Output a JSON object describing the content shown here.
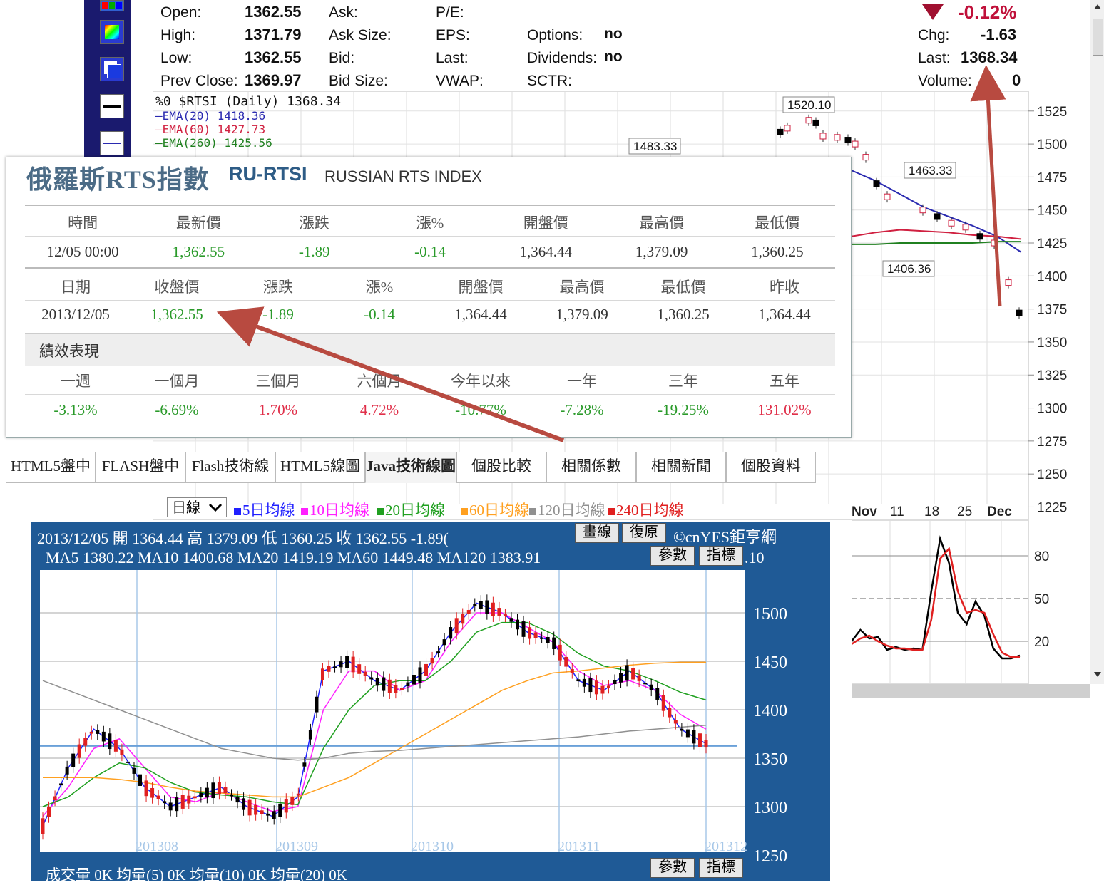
{
  "quote": {
    "open_label": "Open:",
    "open": "1362.55",
    "high_label": "High:",
    "high": "1371.79",
    "low_label": "Low:",
    "low": "1362.55",
    "prev_close_label": "Prev Close:",
    "prev_close": "1369.97",
    "ask_label": "Ask:",
    "ask_size_label": "Ask Size:",
    "bid_label": "Bid:",
    "bid_size_label": "Bid Size:",
    "pe_label": "P/E:",
    "eps_label": "EPS:",
    "last2_label": "Last:",
    "vwap_label": "VWAP:",
    "options_label": "Options:",
    "options": "no",
    "dividends_label": "Dividends:",
    "dividends": "no",
    "sctr_label": "SCTR:",
    "pct_change": "-0.12%",
    "chg_label": "Chg:",
    "chg": "-1.63",
    "last_label": "Last:",
    "last": "1368.34",
    "volume_label": "Volume:",
    "volume": "0"
  },
  "sc_chart": {
    "series_label": "$RTSI (Daily) 1368.34",
    "series_prefix": "%0",
    "ema20": "EMA(20) 1418.36",
    "ema60": "EMA(60) 1427.73",
    "ema260": "EMA(260) 1425.56",
    "annotations": [
      "1520.10",
      "1483.33",
      "1463.33",
      "1406.36"
    ],
    "x_ticks": [
      "Nov",
      "11",
      "18",
      "25",
      "Dec"
    ],
    "colors": {
      "ema20": "#2a2ab0",
      "ema60": "#d02040",
      "ema260": "#208020"
    }
  },
  "chart_data": [
    {
      "type": "line",
      "title": "$RTSI (Daily) 1368.34",
      "y_ticks": [
        "1525",
        "1500",
        "1475",
        "1450",
        "1425",
        "1400",
        "1375",
        "1350",
        "1325",
        "1300",
        "1275",
        "1250",
        "1225"
      ],
      "ylim": [
        1215,
        1540
      ],
      "x": [
        "Nov",
        "11",
        "18",
        "25",
        "Dec"
      ],
      "series": [
        {
          "name": "EMA(20) 1418.36",
          "values": [
            1480,
            1472,
            1462,
            1452,
            1445,
            1438,
            1430,
            1418
          ]
        },
        {
          "name": "EMA(60) 1427.73",
          "values": [
            1430,
            1433,
            1435,
            1434,
            1433,
            1431,
            1430,
            1428
          ]
        },
        {
          "name": "EMA(260) 1425.56",
          "values": [
            1424,
            1424,
            1425,
            1425,
            1425,
            1425,
            1426,
            1426
          ]
        }
      ]
    },
    {
      "type": "line",
      "title": "",
      "y_ticks": [
        "80",
        "50",
        "20"
      ],
      "ylim": [
        0,
        100
      ],
      "series": [
        {
          "name": "",
          "values": [
            20,
            28,
            22,
            23,
            14,
            16,
            14,
            15,
            14,
            55,
            92,
            75,
            40,
            32,
            48,
            38,
            15,
            8,
            8,
            10
          ]
        },
        {
          "name": "",
          "values": [
            18,
            22,
            24,
            20,
            17,
            15,
            15,
            14,
            14,
            35,
            78,
            85,
            55,
            40,
            42,
            40,
            25,
            12,
            9,
            9
          ]
        }
      ]
    },
    {
      "type": "line",
      "title": "2013/12/05 開 1364.44 高 1379.09 低 1360.25 收 1362.55 -1.89",
      "y_ticks": [
        "1500",
        "1450",
        "1400",
        "1350",
        "1300",
        "1250"
      ],
      "ylim": [
        1250,
        1550
      ],
      "x_ticks": [
        "201308",
        "201309",
        "201310",
        "201311",
        "201312"
      ],
      "series": [
        {
          "name": "5日均線",
          "values": [
            1280,
            1340,
            1380,
            1360,
            1320,
            1300,
            1310,
            1320,
            1300,
            1290,
            1310,
            1440,
            1450,
            1430,
            1420,
            1440,
            1480,
            1510,
            1500,
            1480,
            1470,
            1430,
            1420,
            1440,
            1420,
            1380,
            1365
          ]
        },
        {
          "name": "10日均線",
          "values": [
            1290,
            1320,
            1360,
            1370,
            1340,
            1310,
            1305,
            1315,
            1305,
            1295,
            1300,
            1400,
            1440,
            1440,
            1420,
            1430,
            1470,
            1500,
            1500,
            1485,
            1470,
            1440,
            1425,
            1430,
            1420,
            1395,
            1380
          ]
        },
        {
          "name": "20日均線",
          "values": [
            1300,
            1310,
            1330,
            1345,
            1340,
            1325,
            1315,
            1312,
            1310,
            1305,
            1302,
            1360,
            1400,
            1425,
            1430,
            1430,
            1450,
            1480,
            1490,
            1490,
            1478,
            1458,
            1445,
            1440,
            1430,
            1418,
            1410
          ]
        },
        {
          "name": "60日均線",
          "values": [
            1330,
            1330,
            1330,
            1328,
            1325,
            1320,
            1316,
            1314,
            1312,
            1310,
            1310,
            1320,
            1330,
            1345,
            1360,
            1375,
            1390,
            1405,
            1420,
            1430,
            1438,
            1440,
            1443,
            1446,
            1448,
            1449,
            1449
          ]
        },
        {
          "name": "120日均線",
          "values": [
            1430,
            1420,
            1410,
            1400,
            1390,
            1380,
            1370,
            1360,
            1355,
            1350,
            1348,
            1350,
            1355,
            1357,
            1358,
            1360,
            1362,
            1364,
            1366,
            1368,
            1370,
            1372,
            1375,
            1378,
            1380,
            1382,
            1384
          ]
        }
      ]
    }
  ],
  "cnyes": {
    "title_zh": "俄羅斯RTS指數",
    "code": "RU-RTSI",
    "title_en": "RUSSIAN RTS INDEX",
    "row1_headers": [
      "時間",
      "最新價",
      "漲跌",
      "漲%",
      "開盤價",
      "最高價",
      "最低價"
    ],
    "row1_values": [
      "12/05 00:00",
      "1,362.55",
      "-1.89",
      "-0.14",
      "1,364.44",
      "1,379.09",
      "1,360.25"
    ],
    "row2_headers": [
      "日期",
      "收盤價",
      "漲跌",
      "漲%",
      "開盤價",
      "最高價",
      "最低價",
      "昨收"
    ],
    "row2_values": [
      "2013/12/05",
      "1,362.55",
      "-1.89",
      "-0.14",
      "1,364.44",
      "1,379.09",
      "1,360.25",
      "1,364.44"
    ],
    "perf_title": "績效表現",
    "perf_headers": [
      "一週",
      "一個月",
      "三個月",
      "六個月",
      "今年以來",
      "一年",
      "三年",
      "五年"
    ],
    "perf_values": [
      "-3.13%",
      "-6.69%",
      "1.70%",
      "4.72%",
      "-10.77%",
      "-7.28%",
      "-19.25%",
      "131.02%"
    ],
    "colors": {
      "up": "#e0304a",
      "down": "#2a9a2a",
      "neutral": "#333333",
      "title": "#4b6b86"
    }
  },
  "tabs": [
    "HTML5盤中",
    "FLASH盤中",
    "Flash技術線",
    "HTML5線圖",
    "Java技術線圖",
    "個股比較",
    "相關係數",
    "相關新聞",
    "個股資料"
  ],
  "ma_legend": {
    "period": "日線",
    "items": [
      "5日均線",
      "10日均線",
      "20日均線",
      "60日均線",
      "120日均線",
      "240日均線"
    ],
    "colors": [
      "#2020ff",
      "#ff20ff",
      "#20a020",
      "#ffa020",
      "#909090",
      "#e02020"
    ]
  },
  "cn_chart": {
    "info_line1": "2013/12/05 開 1364.44 高 1379.09 低 1360.25 收 1362.55 -1.89(",
    "info_line2": "MA5 1380.22  MA10 1400.68  MA20 1419.19  MA60 1449.48  MA120 1383.91",
    "info_tail": ".10",
    "copyright": "©cnYES鉅亨網",
    "btn_draw": "畫線",
    "btn_reset": "復原",
    "btn_params": "參數",
    "btn_indicator": "指標",
    "volume_line": "成交量 0K  均量(5) 0K  均量(10) 0K  均量(20) 0K"
  }
}
